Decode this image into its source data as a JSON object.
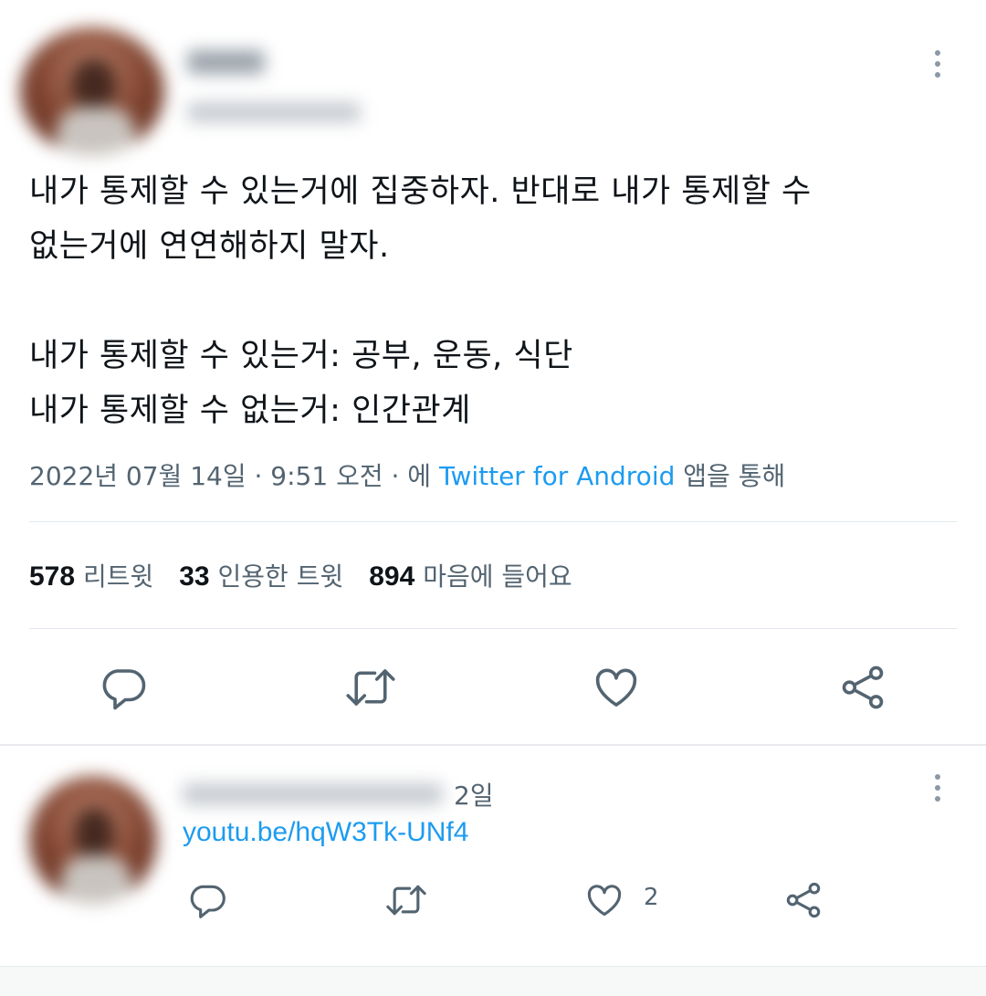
{
  "main_tweet": {
    "text_lines": [
      "내가 통제할 수 있는거에 집중하자. 반대로 내가 통제할 수",
      "없는거에 연연해하지 말자.",
      "",
      "내가 통제할 수 있는거: 공부, 운동, 식단",
      "내가 통제할 수 없는거: 인간관계"
    ],
    "timestamp": "2022년 07월 14일 · 9:51 오전 · 에 ",
    "source_app": "Twitter for Android",
    "source_suffix": " 앱을 통해",
    "stats": {
      "retweets": "578",
      "retweets_label": "리트윗",
      "quotes": "33",
      "quotes_label": "인용한 트윗",
      "likes": "894",
      "likes_label": "마음에 들어요"
    },
    "actions": [
      "reply-icon",
      "retweet-icon",
      "like-icon",
      "share-icon"
    ]
  },
  "reply": {
    "time": "2일",
    "link": "youtu.be/hqW3Tk-UNf4",
    "like_count": "2",
    "actions": [
      "reply-icon",
      "retweet-icon",
      "like-icon",
      "share-icon"
    ]
  },
  "colors": {
    "accent": "#1d9bf0",
    "secondary_text": "#536471",
    "primary_text": "#0f1419",
    "divider": "#e1e8ed"
  }
}
